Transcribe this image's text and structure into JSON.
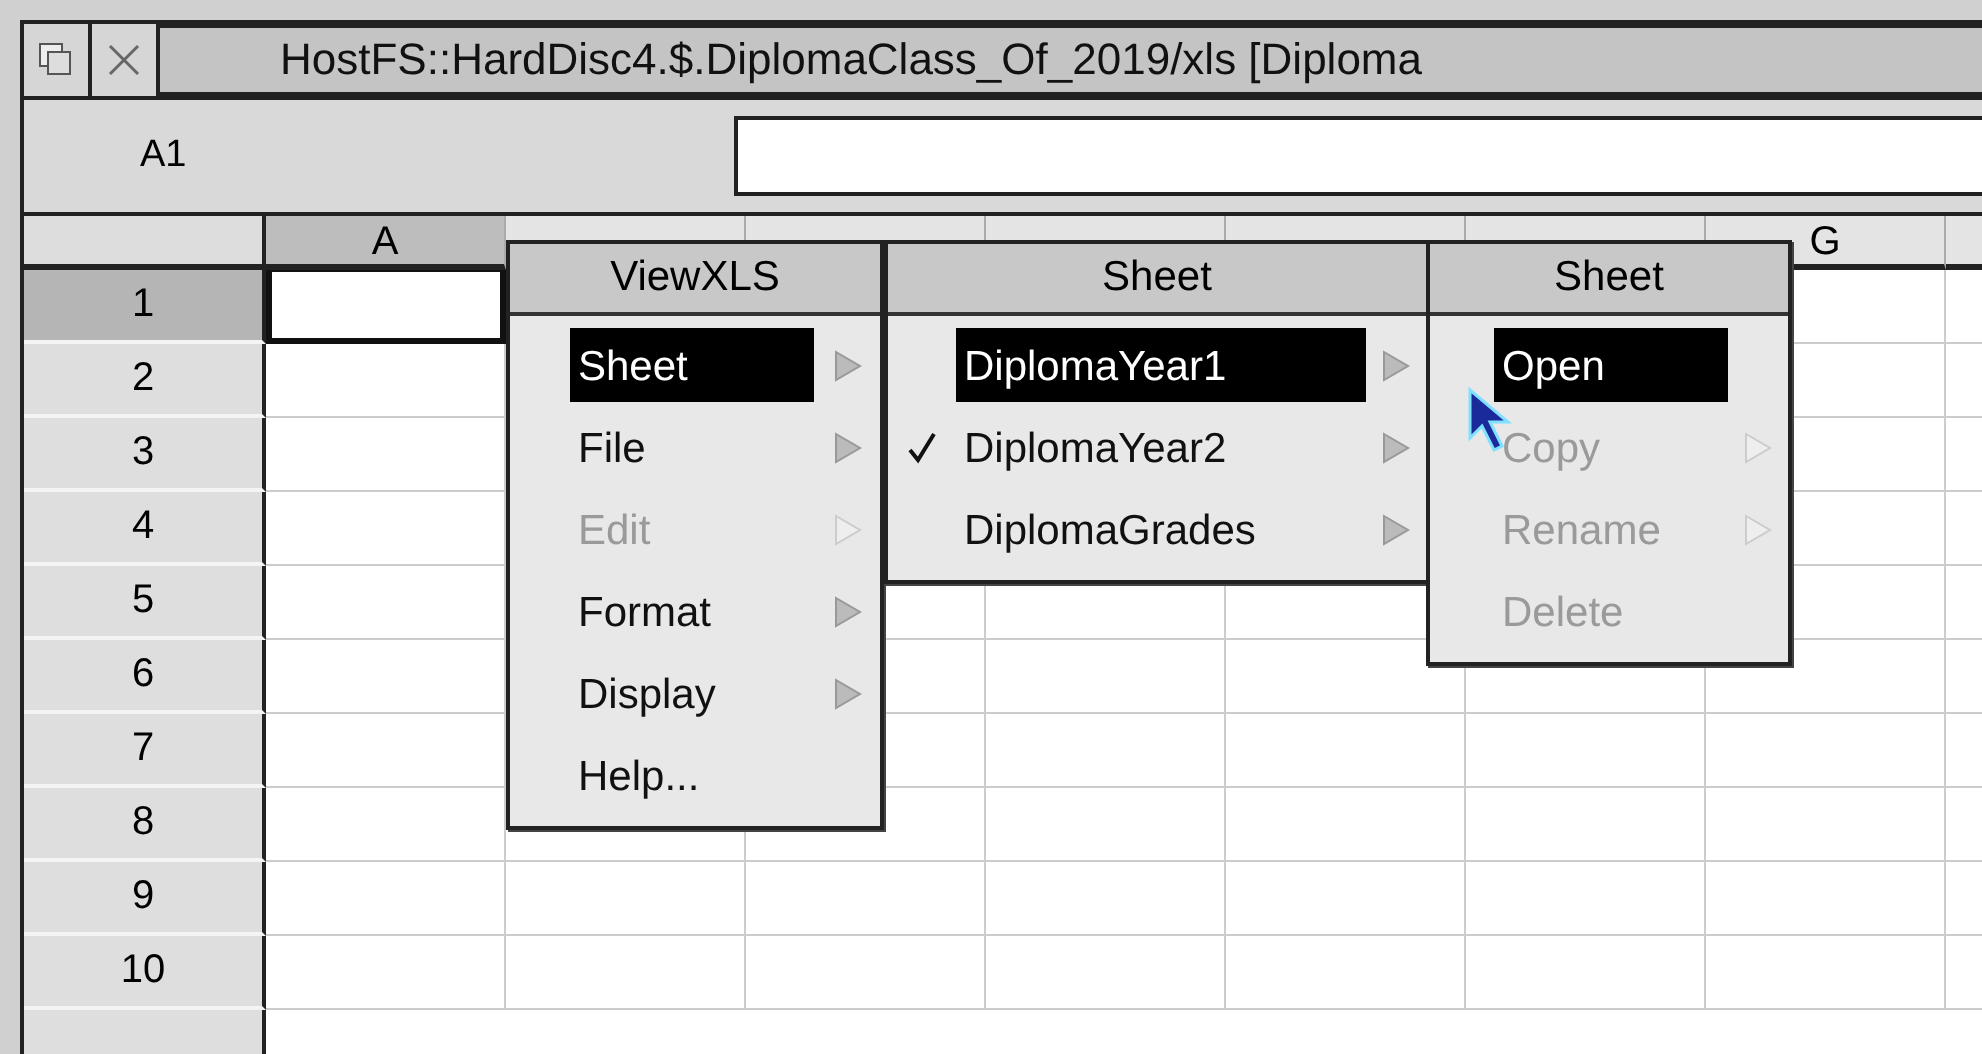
{
  "window": {
    "title": "HostFS::HardDisc4.$.DiplomaClass_Of_2019/xls [Diploma"
  },
  "cell_reference": "A1",
  "sheet": {
    "columns": [
      {
        "label": "A",
        "selected": true
      },
      {
        "selected": false
      },
      {
        "selected": false
      },
      {
        "selected": false
      },
      {
        "selected": false
      },
      {
        "selected": false
      },
      {
        "label": "G",
        "selected": false
      }
    ],
    "rows": [
      {
        "label": "1",
        "selected": true
      },
      {
        "label": "2",
        "selected": false
      },
      {
        "label": "3",
        "selected": false
      },
      {
        "label": "4",
        "selected": false
      },
      {
        "label": "5",
        "selected": false
      },
      {
        "label": "6",
        "selected": false
      },
      {
        "label": "7",
        "selected": false
      },
      {
        "label": "8",
        "selected": false
      },
      {
        "label": "9",
        "selected": false
      },
      {
        "label": "10",
        "selected": false
      }
    ]
  },
  "menus": [
    {
      "title": "ViewXLS",
      "items": [
        {
          "label": "Sheet",
          "selected": true,
          "disabled": false,
          "checked": false,
          "submenu": true
        },
        {
          "label": "File",
          "selected": false,
          "disabled": false,
          "checked": false,
          "submenu": true
        },
        {
          "label": "Edit",
          "selected": false,
          "disabled": true,
          "checked": false,
          "submenu": true
        },
        {
          "label": "Format",
          "selected": false,
          "disabled": false,
          "checked": false,
          "submenu": true
        },
        {
          "label": "Display",
          "selected": false,
          "disabled": false,
          "checked": false,
          "submenu": true
        },
        {
          "label": "Help...",
          "selected": false,
          "disabled": false,
          "checked": false,
          "submenu": false
        }
      ]
    },
    {
      "title": "Sheet",
      "items": [
        {
          "label": "DiplomaYear1",
          "selected": true,
          "disabled": false,
          "checked": false,
          "submenu": true
        },
        {
          "label": "DiplomaYear2",
          "selected": false,
          "disabled": false,
          "checked": true,
          "submenu": true
        },
        {
          "label": "DiplomaGrades",
          "selected": false,
          "disabled": false,
          "checked": false,
          "submenu": true
        }
      ]
    },
    {
      "title": "Sheet",
      "items": [
        {
          "label": "Open",
          "selected": true,
          "disabled": false,
          "checked": false,
          "submenu": false
        },
        {
          "label": "Copy",
          "selected": false,
          "disabled": true,
          "checked": false,
          "submenu": true
        },
        {
          "label": "Rename",
          "selected": false,
          "disabled": true,
          "checked": false,
          "submenu": true
        },
        {
          "label": "Delete",
          "selected": false,
          "disabled": true,
          "checked": false,
          "submenu": false
        }
      ]
    }
  ]
}
